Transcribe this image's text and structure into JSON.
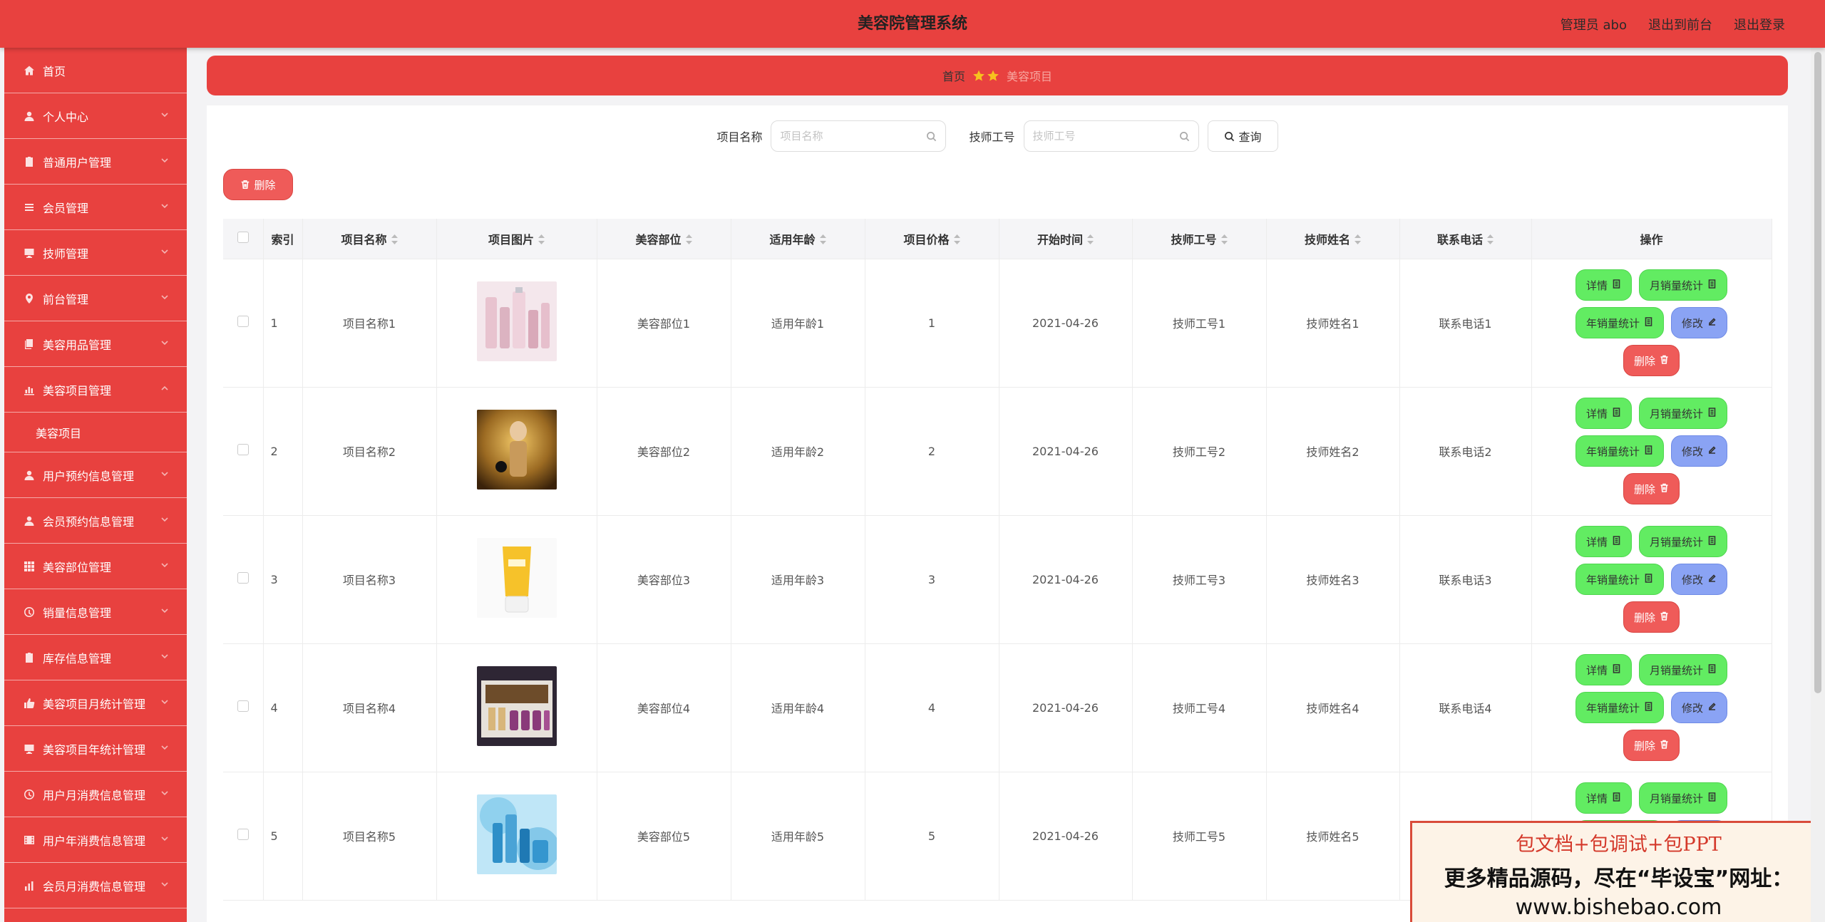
{
  "header": {
    "title": "美容院管理系统",
    "admin_label": "管理员 abo",
    "front_link": "退出到前台",
    "logout_link": "退出登录"
  },
  "sidebar": {
    "items": [
      {
        "label": "首页",
        "icon": "home-icon",
        "has_children": false
      },
      {
        "label": "个人中心",
        "icon": "user-icon",
        "has_children": true
      },
      {
        "label": "普通用户管理",
        "icon": "clipboard-icon",
        "has_children": true
      },
      {
        "label": "会员管理",
        "icon": "list-icon",
        "has_children": true
      },
      {
        "label": "技师管理",
        "icon": "monitor-icon",
        "has_children": true
      },
      {
        "label": "前台管理",
        "icon": "location-icon",
        "has_children": true
      },
      {
        "label": "美容用品管理",
        "icon": "copy-icon",
        "has_children": true
      },
      {
        "label": "美容项目管理",
        "icon": "chart-icon",
        "has_children": true,
        "expanded": true
      },
      {
        "label": "用户预约信息管理",
        "icon": "user-icon",
        "has_children": true
      },
      {
        "label": "会员预约信息管理",
        "icon": "user-icon",
        "has_children": true
      },
      {
        "label": "美容部位管理",
        "icon": "grid-icon",
        "has_children": true
      },
      {
        "label": "销量信息管理",
        "icon": "gauge-icon",
        "has_children": true
      },
      {
        "label": "库存信息管理",
        "icon": "clipboard-icon",
        "has_children": true
      },
      {
        "label": "美容项目月统计管理",
        "icon": "thumb-icon",
        "has_children": true
      },
      {
        "label": "美容项目年统计管理",
        "icon": "monitor-icon",
        "has_children": true
      },
      {
        "label": "用户月消费信息管理",
        "icon": "clock-icon",
        "has_children": true
      },
      {
        "label": "用户年消费信息管理",
        "icon": "film-icon",
        "has_children": true
      },
      {
        "label": "会员月消费信息管理",
        "icon": "bar-chart-icon",
        "has_children": true
      }
    ],
    "sub_item": "美容项目"
  },
  "breadcrumb": {
    "home": "首页",
    "current": "美容项目"
  },
  "search": {
    "name_label": "项目名称",
    "name_placeholder": "项目名称",
    "tech_label": "技师工号",
    "tech_placeholder": "技师工号",
    "query_label": "查询"
  },
  "toolbar": {
    "delete_label": "删除"
  },
  "table": {
    "columns": [
      "索引",
      "项目名称",
      "项目图片",
      "美容部位",
      "适用年龄",
      "项目价格",
      "开始时间",
      "技师工号",
      "技师姓名",
      "联系电话",
      "操作"
    ],
    "rows": [
      {
        "index": "1",
        "name": "项目名称1",
        "image": "cosmetic-bottles-pink",
        "part": "美容部位1",
        "age": "适用年龄1",
        "price": "1",
        "start": "2021-04-26",
        "tech_no": "技师工号1",
        "tech_name": "技师姓名1",
        "phone": "联系电话1"
      },
      {
        "index": "2",
        "name": "项目名称2",
        "image": "perfume-gold",
        "part": "美容部位2",
        "age": "适用年龄2",
        "price": "2",
        "start": "2021-04-26",
        "tech_no": "技师工号2",
        "tech_name": "技师姓名2",
        "phone": "联系电话2"
      },
      {
        "index": "3",
        "name": "项目名称3",
        "image": "yellow-tube",
        "part": "美容部位3",
        "age": "适用年龄3",
        "price": "3",
        "start": "2021-04-26",
        "tech_no": "技师工号3",
        "tech_name": "技师姓名3",
        "phone": "联系电话3"
      },
      {
        "index": "4",
        "name": "项目名称4",
        "image": "gift-box-set",
        "part": "美容部位4",
        "age": "适用年龄4",
        "price": "4",
        "start": "2021-04-26",
        "tech_no": "技师工号4",
        "tech_name": "技师姓名4",
        "phone": "联系电话4"
      },
      {
        "index": "5",
        "name": "项目名称5",
        "image": "blue-splash",
        "part": "美容部位5",
        "age": "适用年龄5",
        "price": "5",
        "start": "2021-04-26",
        "tech_no": "技师工号5",
        "tech_name": "技师姓名5",
        "phone": ""
      }
    ],
    "actions": {
      "detail": "详情",
      "monthly": "月销量统计",
      "yearly": "年销量统计",
      "edit": "修改",
      "delete": "删除"
    }
  },
  "watermark": {
    "line1": "包文档+包调试+包PPT",
    "line2": "更多精品源码，尽在“毕设宝”网址：",
    "line3": "www.bishebao.com"
  },
  "colors": {
    "primary_red": "#e8413f",
    "action_green": "#62ec62",
    "action_blue": "#8aa3f4",
    "action_red": "#ef5b59",
    "star_yellow": "#f7c21f"
  }
}
